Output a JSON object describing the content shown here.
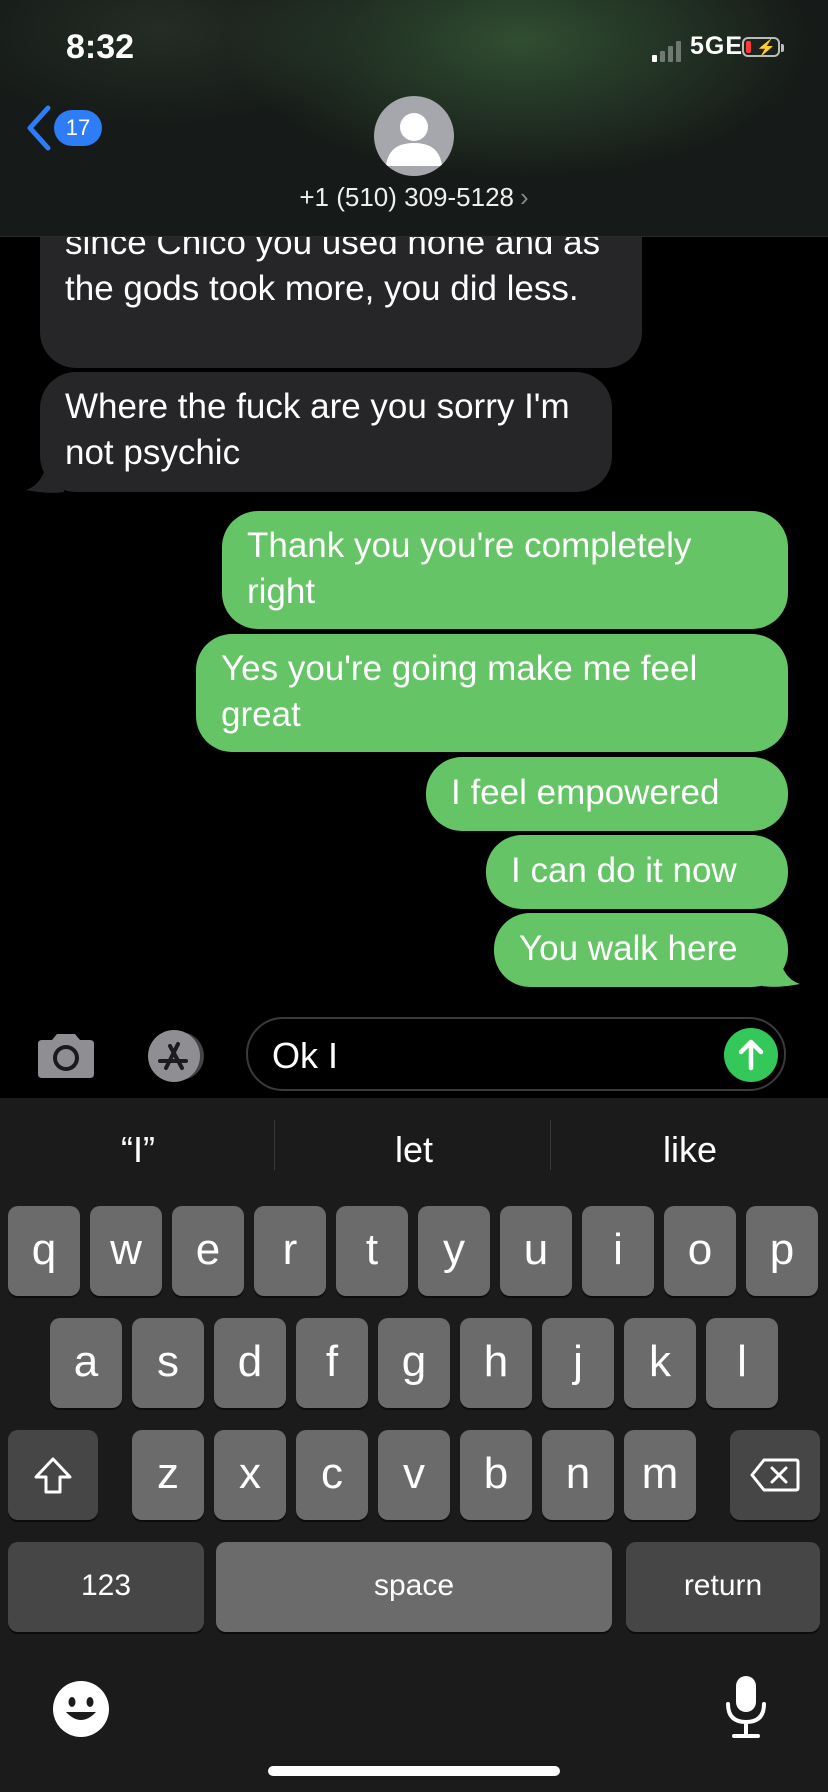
{
  "status_bar": {
    "time": "8:32",
    "network": "5GE",
    "signal_bars_active": 1,
    "battery_level": 0.1
  },
  "header": {
    "back_badge": "17",
    "contact_name": "+1 (510) 309-5128",
    "contact_chevron": "›"
  },
  "messages": [
    {
      "direction": "incoming",
      "text": "since Chico you used none and as the gods took more, you did less."
    },
    {
      "direction": "incoming",
      "text": "Where the fuck are you sorry I'm not psychic"
    },
    {
      "direction": "outgoing",
      "text": "Thank you you're completely right"
    },
    {
      "direction": "outgoing",
      "text": "Yes you're going make me feel great"
    },
    {
      "direction": "outgoing",
      "text": "I feel empowered"
    },
    {
      "direction": "outgoing",
      "text": "I can do it now"
    },
    {
      "direction": "outgoing",
      "text": "You walk here"
    }
  ],
  "composer": {
    "value": "Ok I"
  },
  "keyboard": {
    "suggestions": [
      "“I”",
      "let",
      "like"
    ],
    "row1": [
      "q",
      "w",
      "e",
      "r",
      "t",
      "y",
      "u",
      "i",
      "o",
      "p"
    ],
    "row2": [
      "a",
      "s",
      "d",
      "f",
      "g",
      "h",
      "j",
      "k",
      "l"
    ],
    "row3": [
      "z",
      "x",
      "c",
      "v",
      "b",
      "n",
      "m"
    ],
    "numbers_label": "123",
    "space_label": "space",
    "return_label": "return"
  },
  "colors": {
    "outgoing_bubble": "#65c466",
    "incoming_bubble": "#262628",
    "send_button": "#34c759",
    "badge": "#2f7df6"
  },
  "icons": [
    "camera-icon",
    "app-store-icon",
    "send-arrow-icon",
    "shift-icon",
    "delete-icon",
    "emoji-icon",
    "microphone-icon",
    "back-chevron-icon",
    "person-icon"
  ]
}
